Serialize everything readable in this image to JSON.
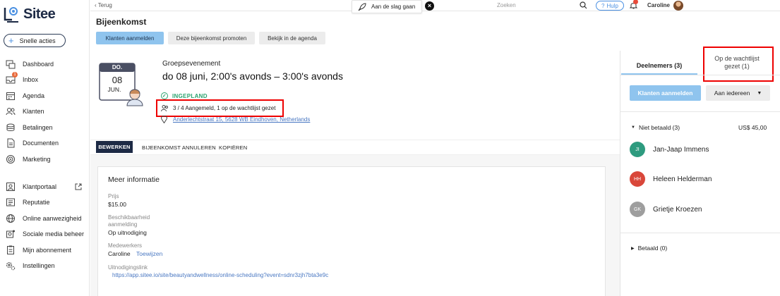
{
  "app": {
    "name": "Sitee"
  },
  "sidebar": {
    "quick_actions": "Snelle acties",
    "items": [
      {
        "label": "Dashboard",
        "icon": "dashboard-icon"
      },
      {
        "label": "Inbox",
        "icon": "inbox-icon",
        "badge": "1"
      },
      {
        "label": "Agenda",
        "icon": "calendar-icon"
      },
      {
        "label": "Klanten",
        "icon": "customers-icon"
      },
      {
        "label": "Betalingen",
        "icon": "payments-icon"
      },
      {
        "label": "Documenten",
        "icon": "documents-icon"
      },
      {
        "label": "Marketing",
        "icon": "marketing-icon"
      },
      {
        "label": "Klantportaal",
        "icon": "portal-icon"
      },
      {
        "label": "Reputatie",
        "icon": "reputation-icon"
      },
      {
        "label": "Online aanwezigheid",
        "icon": "globe-icon"
      },
      {
        "label": "Sociale media beheer",
        "icon": "social-icon"
      },
      {
        "label": "Mijn abonnement",
        "icon": "subscription-icon"
      },
      {
        "label": "Instellingen",
        "icon": "settings-icon"
      }
    ]
  },
  "topbar": {
    "back": "Terug",
    "getting_started": "Aan de slag gaan",
    "search_placeholder": "Zoeken",
    "help": "Hulp",
    "user": "Caroline"
  },
  "header": {
    "title": "Bijeenkomst",
    "buttons": [
      "Klanten aanmelden",
      "Deze bijeenkomst promoten",
      "Bekijk in de agenda"
    ]
  },
  "event": {
    "calendar_day": "DO.",
    "calendar_date": "08",
    "calendar_month": "JUN.",
    "type": "Groepsevenement",
    "datetime": "do 08 juni, 2:00's avonds – 3:00's avonds",
    "status": "INGEPLAND",
    "attendance": "3 / 4 Aangemeld, 1 op de wachtlijst gezet",
    "address": "Anderlechtstraat 15, 5628 WB Eindhoven, Netherlands"
  },
  "actions": [
    "BEWERKEN",
    "BIJEENKOMST ANNULEREN",
    "KOPIËREN"
  ],
  "info": {
    "title": "Meer informatie",
    "price_label": "Prijs",
    "price": "$15.00",
    "availability_label_1": "Beschikbaarheid",
    "availability_label_2": "aanmelding",
    "availability": "Op uitnodiging",
    "staff_label": "Medewerkers",
    "staff": "Caroline",
    "assign": "Toewijzen",
    "link_label": "Uitnodigingslink",
    "link": "https://app.sitee.io/site/beautyandwellness/online-scheduling?event=sdnr3zjh7bta3e9c"
  },
  "participants": {
    "tab_participants": "Deelnemers (3)",
    "tab_waitlist_1": "Op de wachtlijst",
    "tab_waitlist_2": "gezet (1)",
    "register_button": "Klanten aanmelden",
    "audience_dropdown": "Aan iedereen",
    "unpaid_header": "Niet betaald (3)",
    "unpaid_amount": "US$ 45,00",
    "people": [
      {
        "initials": "JI",
        "name": "Jan-Jaap Immens",
        "color": "#2e9b7f"
      },
      {
        "initials": "HH",
        "name": "Heleen Helderman",
        "color": "#d9473a"
      },
      {
        "initials": "GK",
        "name": "Grietje Kroezen",
        "color": "#9e9e9e"
      }
    ],
    "paid_header": "Betaald (0)"
  },
  "colors": {
    "primary_light": "#8fc4ee",
    "navy": "#1d2a45",
    "highlight": "#e00000",
    "success": "#2aa36f"
  }
}
